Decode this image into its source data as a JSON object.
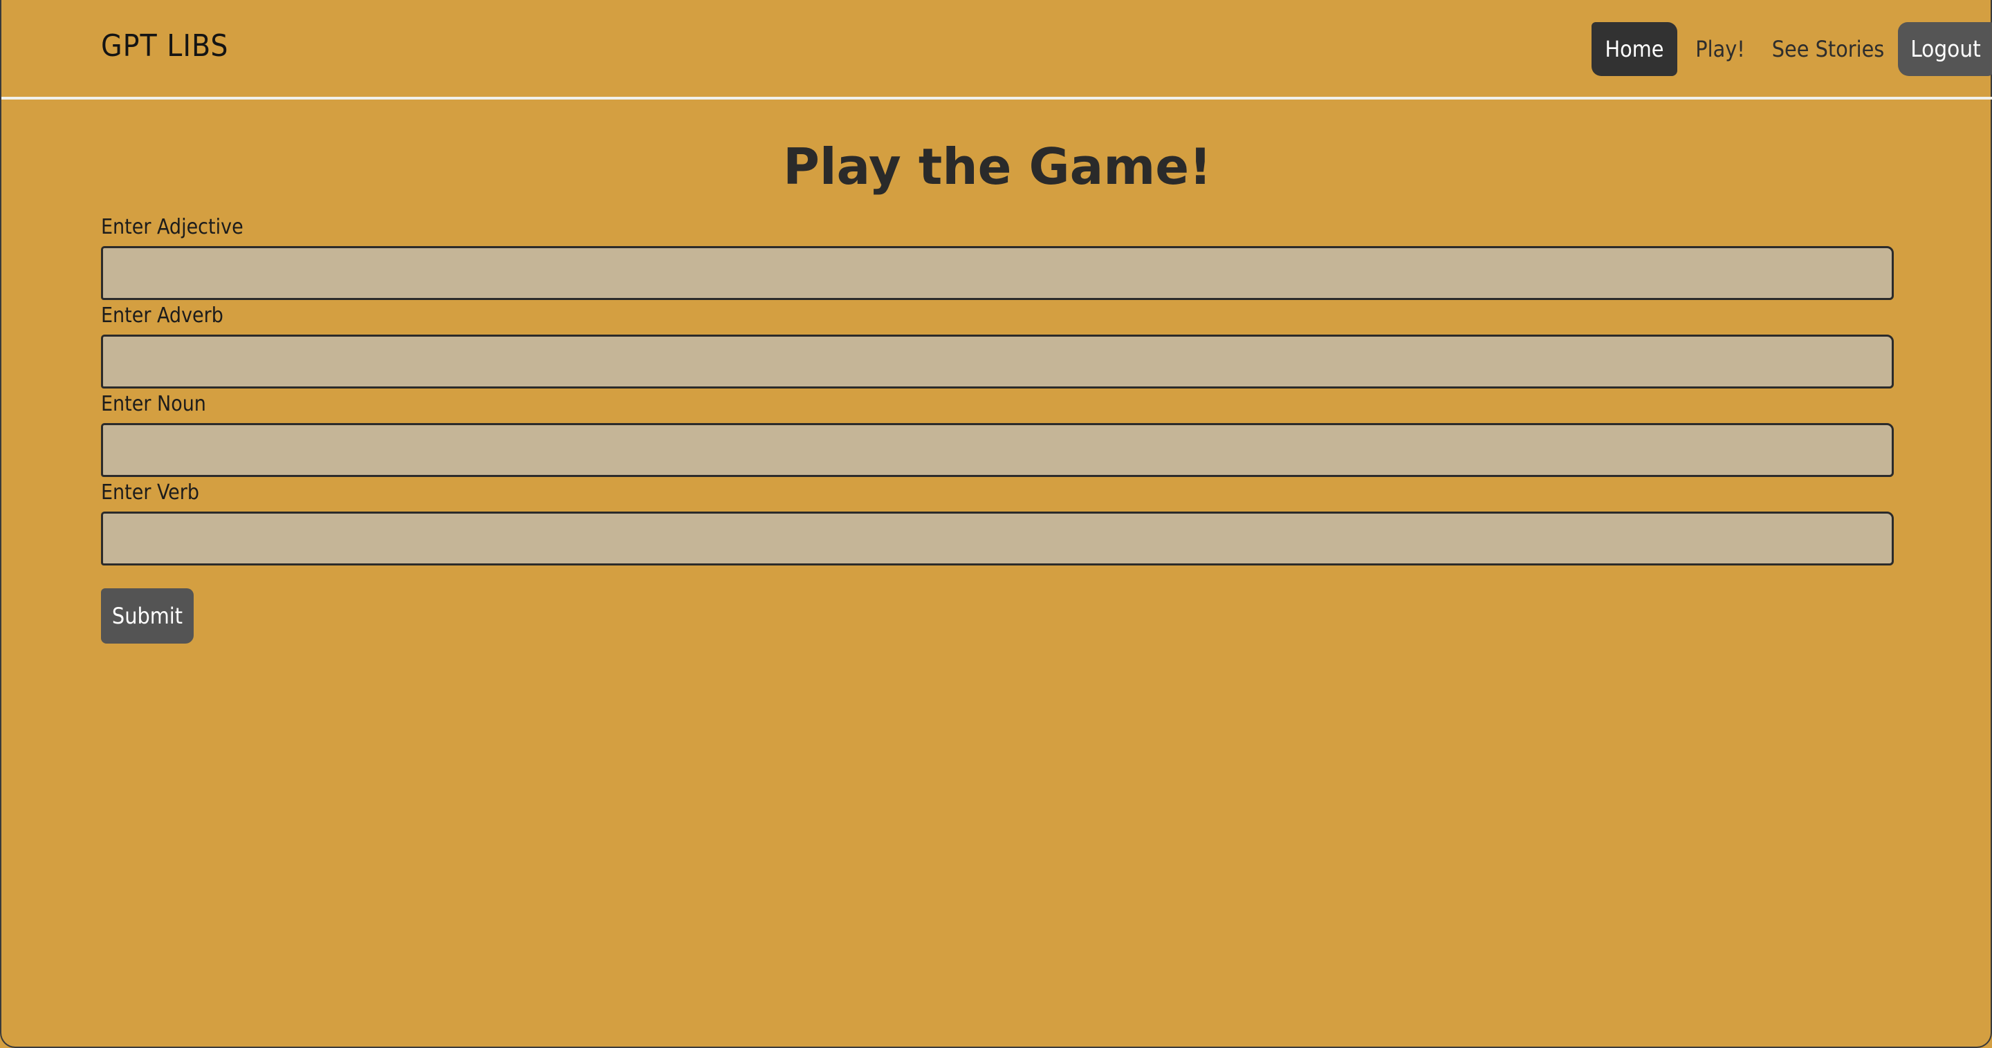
{
  "app": {
    "brand": "GPT LIBS"
  },
  "nav": {
    "items": [
      {
        "label": "Home",
        "active": true
      },
      {
        "label": "Play!",
        "active": false
      },
      {
        "label": "See Stories",
        "active": false
      },
      {
        "label": "Logout",
        "active": false
      }
    ]
  },
  "main": {
    "title": "Play the Game!",
    "fields": [
      {
        "label": "Enter Adjective",
        "value": ""
      },
      {
        "label": "Enter Adverb",
        "value": ""
      },
      {
        "label": "Enter Noun",
        "value": ""
      },
      {
        "label": "Enter Verb",
        "value": ""
      }
    ],
    "submit_label": "Submit"
  },
  "colors": {
    "background": "#d49f41",
    "input_fill": "#c5b597",
    "dark_button": "#323232",
    "gray_button": "#555555",
    "nav_rule": "#f1f1ec"
  }
}
